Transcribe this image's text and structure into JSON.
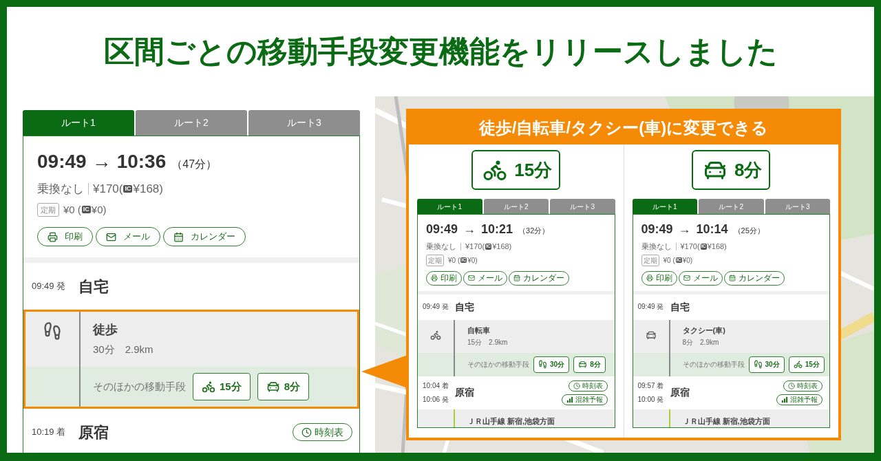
{
  "title": "区間ごとの移動手段変更機能をリリースしました",
  "main_route": {
    "tabs": [
      {
        "label": "ルート1",
        "selected": true
      },
      {
        "label": "ルート2",
        "selected": false
      },
      {
        "label": "ルート3",
        "selected": false
      }
    ],
    "depart": "09:49",
    "arrow": "→",
    "arrive": "10:36",
    "duration": "（47分）",
    "transfers": "乗換なし",
    "fare": {
      "before": "¥170(",
      "ic": "IC",
      "after": "¥168)"
    },
    "pass": {
      "label": "定期",
      "before": "¥0 (",
      "ic": "IC",
      "after": "¥0)"
    },
    "actions": [
      {
        "kind": "print",
        "label": "印刷"
      },
      {
        "kind": "mail",
        "label": "メール"
      },
      {
        "kind": "calendar",
        "label": "カレンダー"
      }
    ],
    "legs": [
      {
        "kind": "stop",
        "times": [
          "09:49 発"
        ],
        "name": "自宅"
      },
      {
        "kind": "walk",
        "name": "徒歩",
        "detail": "30分　2.9km",
        "highlighted": true,
        "alternatives_label": "そのほかの移動手段",
        "alternatives": [
          {
            "kind": "bike",
            "label": "15分"
          },
          {
            "kind": "car",
            "label": "8分"
          }
        ]
      },
      {
        "kind": "stop",
        "times": [
          "10:19 着"
        ],
        "name": "原宿",
        "buttons": [
          {
            "kind": "timetable",
            "label": "時刻表"
          }
        ]
      }
    ]
  },
  "callout": {
    "heading": "徒歩/自転車/タクシー(車)に変更できる",
    "options": [
      {
        "badge": {
          "kind": "bike",
          "label": "15分"
        },
        "route": {
          "tabs": [
            {
              "label": "ルート1",
              "selected": true
            },
            {
              "label": "ルート2",
              "selected": false
            },
            {
              "label": "ルート3",
              "selected": false
            }
          ],
          "depart": "09:49",
          "arrow": "→",
          "arrive": "10:21",
          "duration": "（32分）",
          "transfers": "乗換なし",
          "fare": {
            "before": "¥170(",
            "ic": "IC",
            "after": "¥168)"
          },
          "pass": {
            "label": "定期",
            "before": "¥0 (",
            "ic": "IC",
            "after": "¥0)"
          },
          "actions": [
            {
              "kind": "print",
              "label": "印刷"
            },
            {
              "kind": "mail",
              "label": "メール"
            },
            {
              "kind": "calendar",
              "label": "カレンダー"
            }
          ],
          "legs": [
            {
              "kind": "stop",
              "times": [
                "09:49 発"
              ],
              "name": "自宅"
            },
            {
              "kind": "bike",
              "name": "自転車",
              "detail": "15分　2.9km",
              "highlighted": false,
              "alternatives_label": "そのほかの移動手段",
              "alternatives": [
                {
                  "kind": "walk",
                  "label": "30分"
                },
                {
                  "kind": "car",
                  "label": "8分"
                }
              ]
            },
            {
              "kind": "stop",
              "times": [
                "10:04 着",
                "10:06 発"
              ],
              "name": "原宿",
              "buttons": [
                {
                  "kind": "timetable",
                  "label": "時刻表"
                },
                {
                  "kind": "crowd",
                  "label": "混雑予報"
                }
              ]
            },
            {
              "kind": "train",
              "name": "ＪＲ山手線 新宿,池袋方面"
            }
          ]
        }
      },
      {
        "badge": {
          "kind": "car",
          "label": "8分"
        },
        "route": {
          "tabs": [
            {
              "label": "ルート1",
              "selected": true
            },
            {
              "label": "ルート2",
              "selected": false
            },
            {
              "label": "ルート3",
              "selected": false
            }
          ],
          "depart": "09:49",
          "arrow": "→",
          "arrive": "10:14",
          "duration": "（25分）",
          "transfers": "乗換なし",
          "fare": {
            "before": "¥170(",
            "ic": "IC",
            "after": "¥168)"
          },
          "pass": {
            "label": "定期",
            "before": "¥0 (",
            "ic": "IC",
            "after": "¥0)"
          },
          "actions": [
            {
              "kind": "print",
              "label": "印刷"
            },
            {
              "kind": "mail",
              "label": "メール"
            },
            {
              "kind": "calendar",
              "label": "カレンダー"
            }
          ],
          "legs": [
            {
              "kind": "stop",
              "times": [
                "09:49 発"
              ],
              "name": "自宅"
            },
            {
              "kind": "car",
              "name": "タクシー(車)",
              "detail": "8分　2.9km",
              "highlighted": false,
              "alternatives_label": "そのほかの移動手段",
              "alternatives": [
                {
                  "kind": "walk",
                  "label": "30分"
                },
                {
                  "kind": "bike",
                  "label": "15分"
                }
              ]
            },
            {
              "kind": "stop",
              "times": [
                "09:57 着",
                "10:00 発"
              ],
              "name": "原宿",
              "buttons": [
                {
                  "kind": "timetable",
                  "label": "時刻表"
                },
                {
                  "kind": "crowd",
                  "label": "混雑予報"
                }
              ]
            },
            {
              "kind": "train",
              "name": "ＪＲ山手線 新宿,池袋方面"
            }
          ]
        }
      }
    ]
  }
}
